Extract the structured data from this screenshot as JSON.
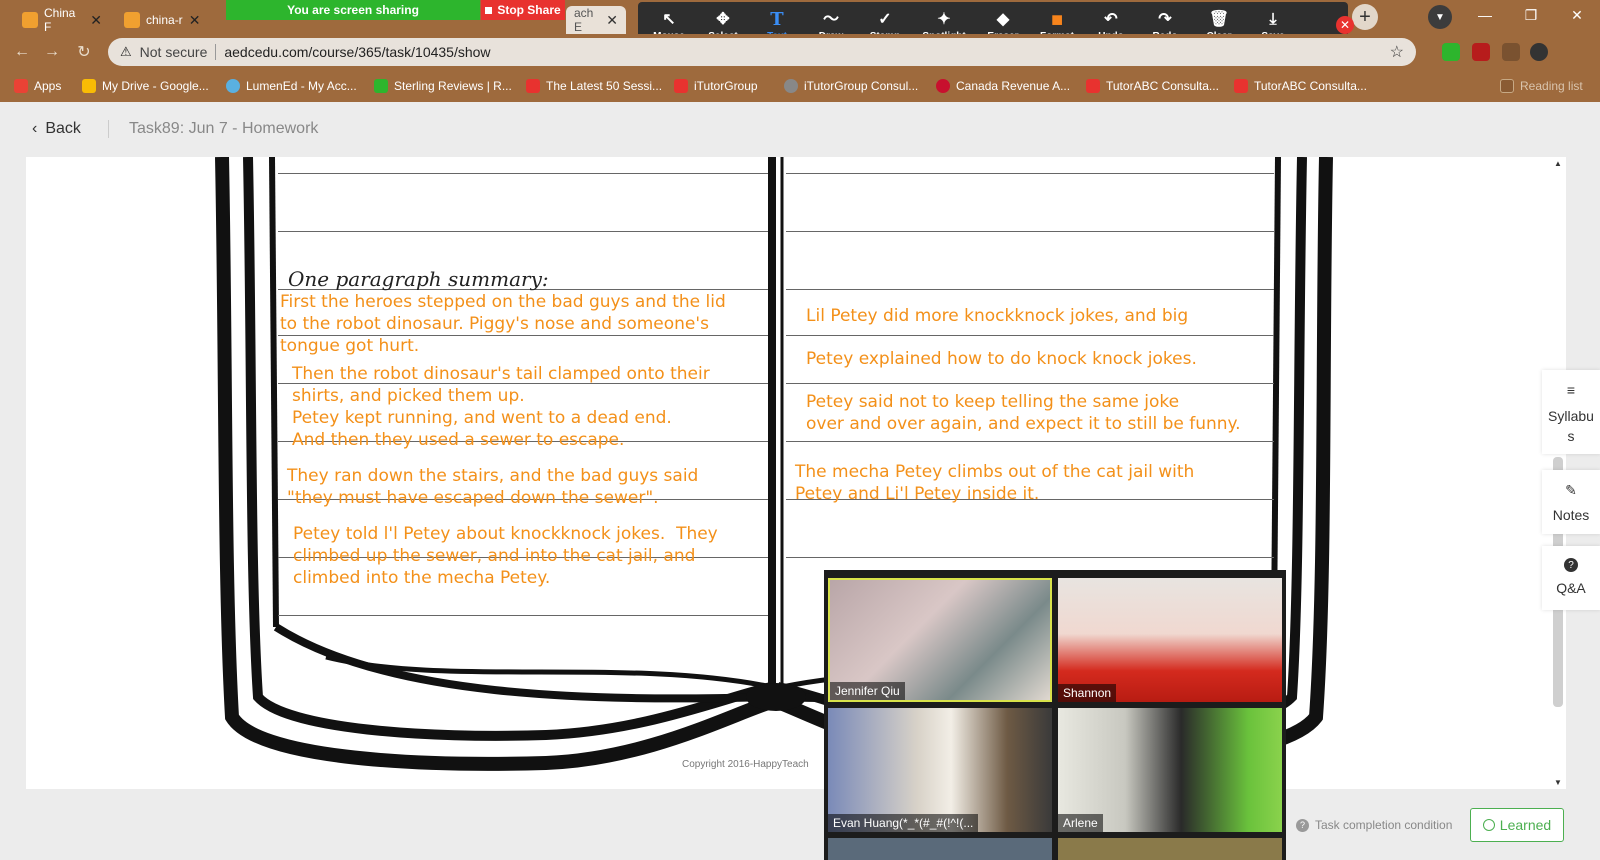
{
  "tabs": [
    {
      "label": "China F",
      "close": "✕"
    },
    {
      "label": "china-r",
      "close": "✕"
    },
    {
      "label": "ach E",
      "close": "✕"
    }
  ],
  "share": {
    "banner": "You are screen sharing",
    "stop": "Stop Share"
  },
  "annotation_tools": [
    {
      "label": "Mouse",
      "icon": "↖"
    },
    {
      "label": "Select",
      "icon": "✥"
    },
    {
      "label": "Text",
      "icon": "T"
    },
    {
      "label": "Draw",
      "icon": "〜"
    },
    {
      "label": "Stamp",
      "icon": "✓"
    },
    {
      "label": "Spotlight",
      "icon": "✦"
    },
    {
      "label": "Eraser",
      "icon": "◆"
    },
    {
      "label": "Format",
      "icon": "■"
    },
    {
      "label": "Undo",
      "icon": "↶"
    },
    {
      "label": "Redo",
      "icon": "↷"
    },
    {
      "label": "Clear",
      "icon": "🗑"
    },
    {
      "label": "Save",
      "icon": "⤓"
    }
  ],
  "address": {
    "security": "Not secure",
    "url": "aedcedu.com/course/365/task/10435/show"
  },
  "bookmarks": [
    {
      "label": "Apps",
      "color": "#e94235"
    },
    {
      "label": "My Drive - Google...",
      "color": "#f9bc05"
    },
    {
      "label": "LumenEd - My Acc...",
      "color": "#5ab0e0"
    },
    {
      "label": "Sterling Reviews | R...",
      "color": "#2db52d"
    },
    {
      "label": "The Latest 50 Sessi...",
      "color": "#e8322f"
    },
    {
      "label": "iTutorGroup",
      "color": "#e8322f"
    },
    {
      "label": "iTutorGroup Consul...",
      "color": "#888888"
    },
    {
      "label": "Canada Revenue A...",
      "color": "#c8102e"
    },
    {
      "label": "TutorABC Consulta...",
      "color": "#e8322f"
    },
    {
      "label": "TutorABC Consulta...",
      "color": "#e8322f"
    },
    {
      "label": "Reading list",
      "color": "#9e6a3d"
    }
  ],
  "page": {
    "back": "Back",
    "title": "Task89:  Jun 7 - Homework"
  },
  "worksheet": {
    "summary_label": "One paragraph summary:",
    "left_notes": [
      "First the heroes stepped on the bad guys and the lid\nto the robot dinosaur. Piggy's nose and someone's\ntongue got hurt.",
      "Then the robot dinosaur's tail clamped onto their\nshirts, and picked them up.\nPetey kept running, and went to a dead end.\nAnd then they used a sewer to escape.",
      "They ran down the stairs, and the bad guys said\n\"they must have escaped down the sewer\".",
      "Petey told l'l Petey about knockknock jokes.  They\nclimbed up the sewer, and into the cat jail, and\nclimbed into the mecha Petey."
    ],
    "right_notes": [
      "Lil Petey did more knockknock jokes, and big",
      "Petey explained how to do knock knock jokes.",
      "Petey said not to keep telling the same joke\nover and over again, and expect it to still be funny.",
      "The mecha Petey climbs out of the cat jail with\nPetey and Li'l Petey inside it."
    ],
    "copyright": "Copyright 2016-HappyTeach"
  },
  "side_panel": [
    {
      "label": "Syllabus",
      "icon": "≡"
    },
    {
      "label": "Notes",
      "icon": "✎"
    },
    {
      "label": "Q&A",
      "icon": "?"
    }
  ],
  "participants": [
    {
      "name": "Jennifer Qiu"
    },
    {
      "name": "Shannon"
    },
    {
      "name": "Evan Huang(*_*(#_#(!^!(..."
    },
    {
      "name": "Arlene"
    }
  ],
  "footer": {
    "task_condition": "Task completion condition",
    "learned": "Learned"
  }
}
